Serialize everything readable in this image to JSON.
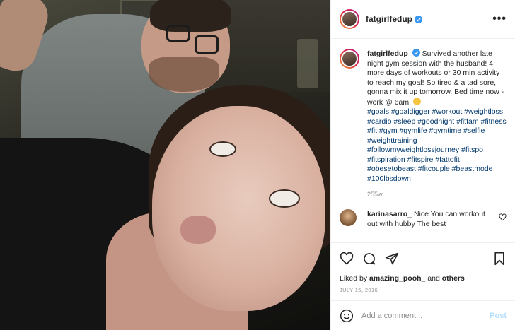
{
  "post": {
    "username": "fatgirlfedup",
    "more_icon": "more-horizontal-icon",
    "caption_text": "Survived another late night gym session with the husband! 4 more days of workouts or 30 min activity to reach my goal! So tired & a tad sore, gonna mix it up tomorrow. Bed time now - work @ 6am.",
    "hashtags": "#goals #goaldigger #workout #weightloss #cardio #sleep #goodnight #fitfam #fitness #fit #gym #gymlife #gymtime #selfie #weighttraining #followmyweightlossjourney #fitspo #fitspiration #fitspire #fattofit #obesetobeast #fitcouple #beastmode #100lbsdown",
    "time_ago": "255w"
  },
  "comment": {
    "username": "karinasarro_",
    "text": "Nice You can workout out with hubby The best"
  },
  "likes": {
    "prefix": "Liked by",
    "user": "amazing_pooh_",
    "and": "and",
    "others": "others"
  },
  "date": "JULY 15, 2016",
  "add_comment": {
    "placeholder": "Add a comment...",
    "post_label": "Post"
  },
  "colors": {
    "link": "#00376b",
    "verified": "#3897f0",
    "muted": "#8e8e8e",
    "post_button": "#b2dffc"
  }
}
